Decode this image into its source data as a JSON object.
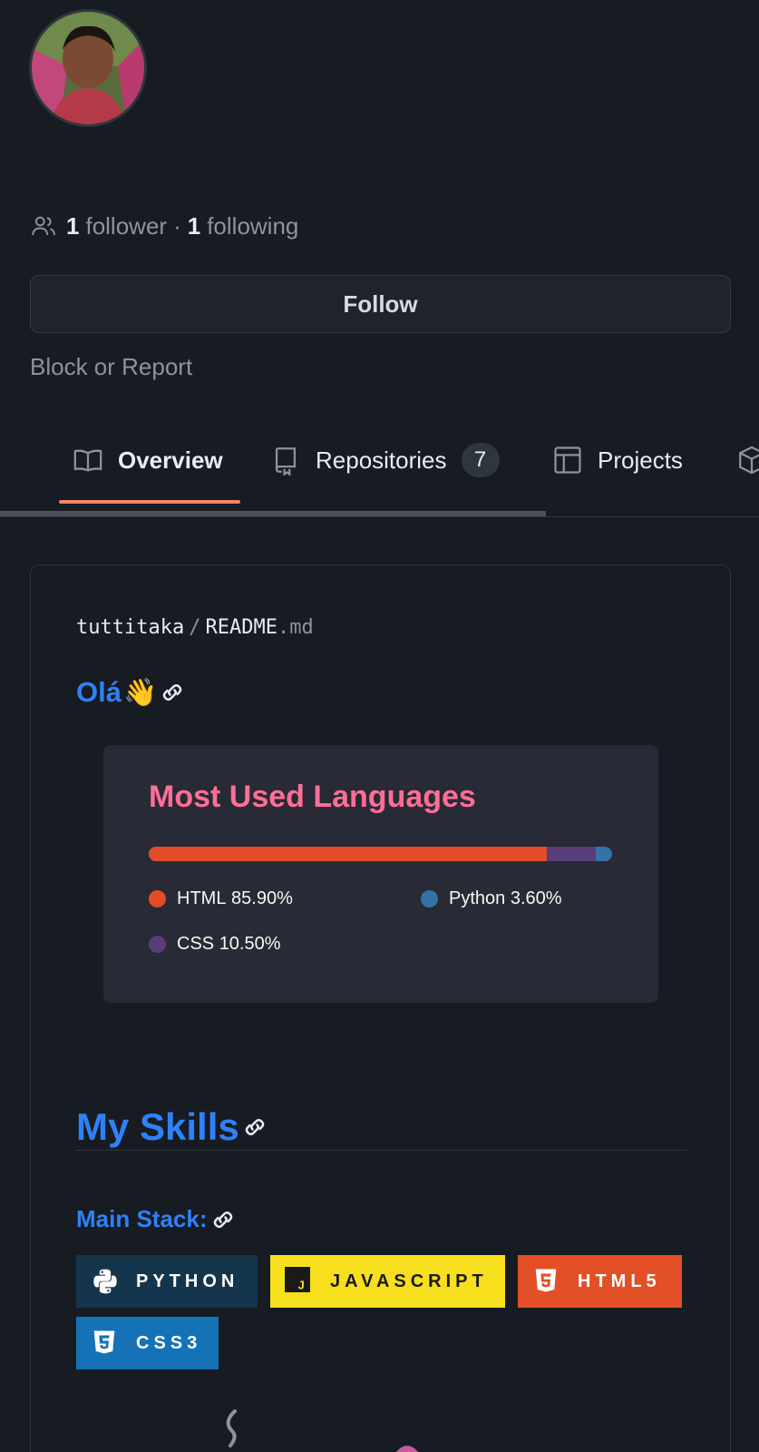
{
  "profile": {
    "avatar_alt": "profile avatar",
    "followers_count": "1",
    "followers_label": "follower",
    "separator": "·",
    "following_count": "1",
    "following_label": "following",
    "follow_button": "Follow",
    "block_report": "Block or Report"
  },
  "tabs": [
    {
      "label": "Overview",
      "icon": "book-icon",
      "active": true
    },
    {
      "label": "Repositories",
      "icon": "repo-icon",
      "count": "7"
    },
    {
      "label": "Projects",
      "icon": "table-icon"
    },
    {
      "label": "",
      "icon": "package-icon"
    }
  ],
  "readme": {
    "owner": "tuttitaka",
    "path_sep": "/",
    "file_name": "README",
    "file_ext": ".md",
    "greeting": "Olá",
    "greeting_emoji": "👋",
    "languages_card": {
      "title": "Most Used Languages",
      "languages": [
        {
          "name": "HTML",
          "percent": "85.90%",
          "value": 85.9,
          "color": "#e34c26"
        },
        {
          "name": "Python",
          "percent": "3.60%",
          "value": 3.6,
          "color": "#3572a5"
        },
        {
          "name": "CSS",
          "percent": "10.50%",
          "value": 10.5,
          "color": "#563d7c"
        }
      ]
    },
    "skills_heading": "My Skills",
    "main_stack_heading": "Main Stack:",
    "badges": [
      {
        "label": "PYTHON",
        "color": "#14354c",
        "icon": "python-icon"
      },
      {
        "label": "JAVASCRIPT",
        "color": "#f7df1e",
        "icon": "javascript-icon"
      },
      {
        "label": "HTML5",
        "color": "#e34f26",
        "icon": "html5-icon"
      },
      {
        "label": "CSS3",
        "color": "#1572b6",
        "icon": "css3-icon"
      }
    ]
  },
  "colors": {
    "background": "#171b22",
    "accent_link": "#2f81f7",
    "tab_underline": "#f78166",
    "lang_title": "#ff6e96",
    "lang_card_bg": "#282a36"
  }
}
